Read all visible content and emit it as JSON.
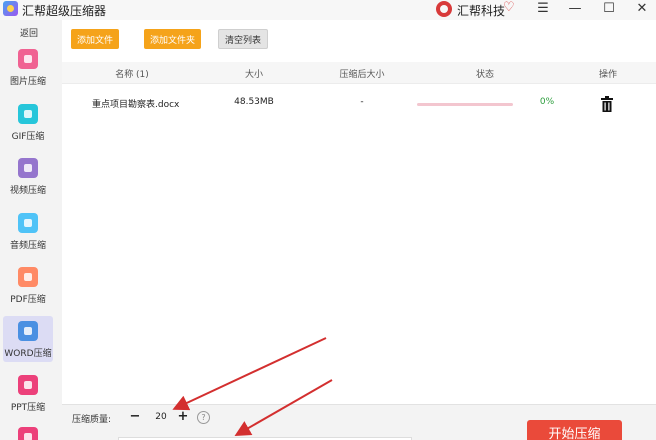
{
  "titlebar": {
    "app_title": "汇帮超级压缩器",
    "brand_name": "汇帮科技",
    "menu_glyph": "☰",
    "minimize_glyph": "—",
    "maximize_glyph": "☐",
    "close_glyph": "✕"
  },
  "sidebar": {
    "back_label": "返回",
    "items": [
      {
        "label": "图片压缩",
        "icon": "image-icon",
        "color": "#f06292"
      },
      {
        "label": "GIF压缩",
        "icon": "gif-icon",
        "color": "#26c6da"
      },
      {
        "label": "视频压缩",
        "icon": "video-icon",
        "color": "#9575cd"
      },
      {
        "label": "音频压缩",
        "icon": "audio-icon",
        "color": "#4fc3f7"
      },
      {
        "label": "PDF压缩",
        "icon": "pdf-icon",
        "color": "#ff8a65"
      },
      {
        "label": "WORD压缩",
        "icon": "word-icon",
        "color": "#4a90e2",
        "active": true
      },
      {
        "label": "PPT压缩",
        "icon": "ppt-icon",
        "color": "#ec407a"
      }
    ]
  },
  "toolbar": {
    "add_file_label": "添加文件",
    "add_folder_label": "添加文件夹",
    "clear_list_label": "清空列表"
  },
  "table": {
    "headers": [
      "名称 (1)",
      "大小",
      "压缩后大小",
      "状态",
      "操作"
    ],
    "rows": [
      {
        "name": "重点项目勘察表.docx",
        "size": "48.53MB",
        "compressed_size": "-",
        "progress": 0,
        "status": "0%"
      }
    ]
  },
  "bottom": {
    "quality_label": "压缩质量:",
    "minus_glyph": "−",
    "plus_glyph": "+",
    "quality_value": "20",
    "help_glyph": "?",
    "start_label": "开始压缩"
  },
  "colors": {
    "accent_orange": "#f5a31a",
    "start_red": "#ea4a3a",
    "active_sidebar": "#dcdcf4",
    "status_green": "#2e9e3e"
  }
}
